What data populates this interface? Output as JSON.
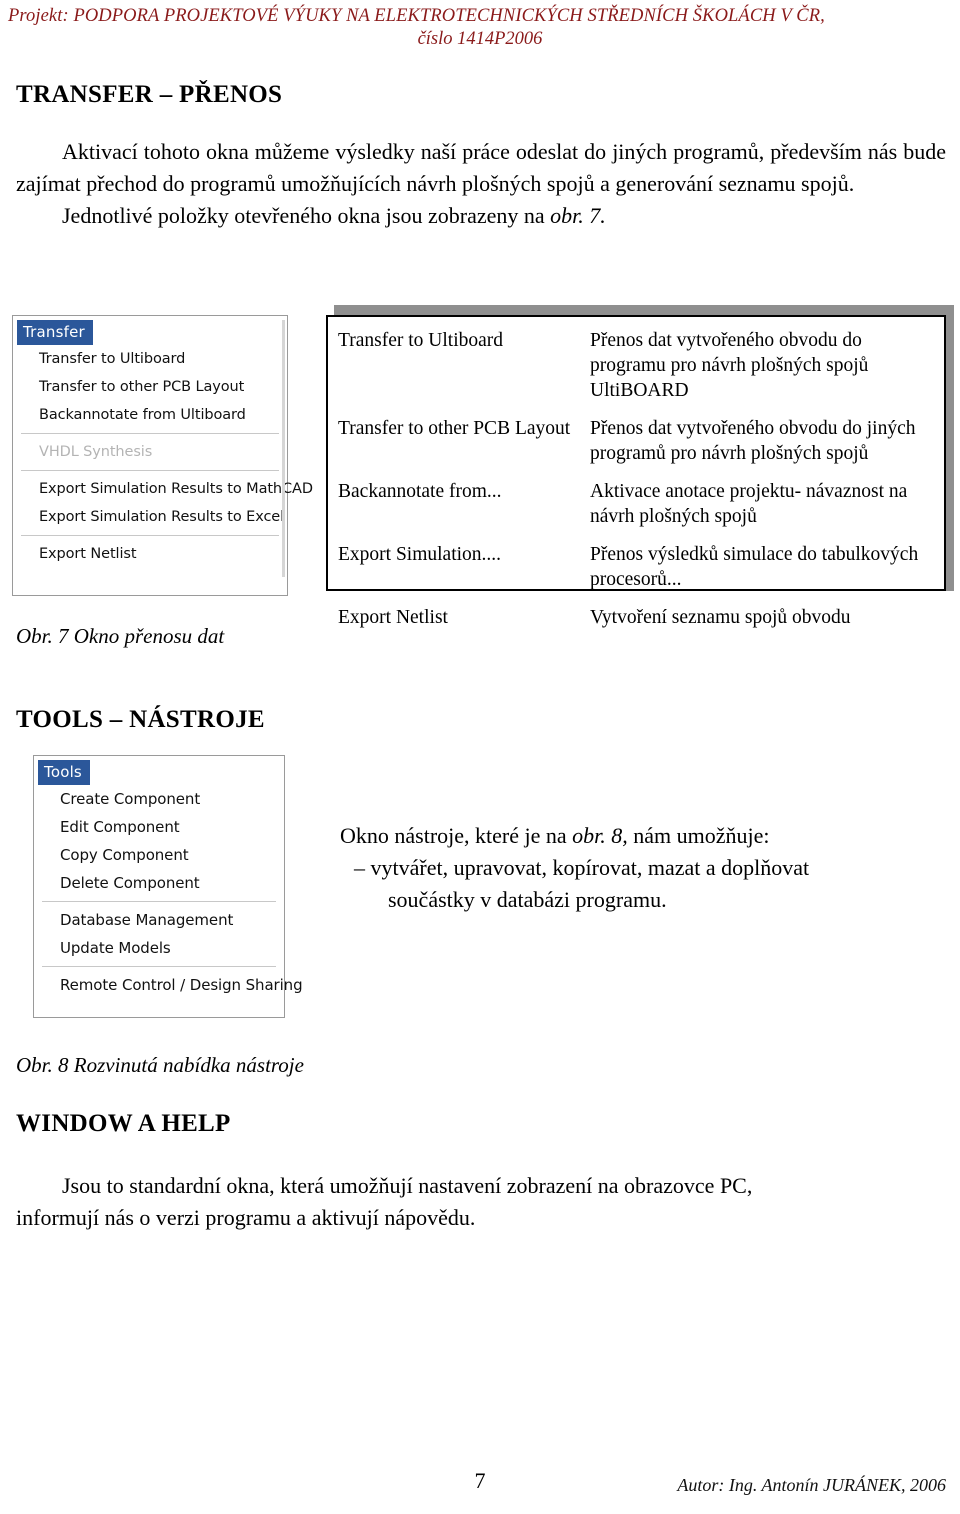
{
  "header": {
    "line1": "Projekt: PODPORA PROJEKTOVÉ VÝUKY NA ELEKTROTECHNICKÝCH STŘEDNÍCH ŠKOLÁCH V ČR,",
    "line2": "číslo 1414P2006",
    "color": "#8a1a1a"
  },
  "sections": {
    "transfer_title": "TRANSFER – PŘENOS",
    "tools_title": "TOOLS – NÁSTROJE",
    "window_title": "WINDOW A HELP"
  },
  "intro_paragraph": {
    "line_a": "Aktivací tohoto okna můžeme výsledky naší práce odeslat do jiných programů, především nás bude zajímat přechod do programů umožňujících návrh plošných spojů a generování seznamu spojů.",
    "line_b_prefix": "Jednotlivé položky otevřeného okna jsou zobrazeny na ",
    "line_b_italic": "obr. 7.",
    "line_b_suffix": ""
  },
  "transfer_menu": {
    "title": "Transfer",
    "title_bg": "#2b579a",
    "groups": [
      {
        "items": [
          {
            "label": "Transfer to Ultiboard",
            "disabled": false
          },
          {
            "label": "Transfer to other PCB Layout",
            "disabled": false
          },
          {
            "label": "Backannotate from Ultiboard",
            "disabled": false
          }
        ]
      },
      {
        "items": [
          {
            "label": "VHDL Synthesis",
            "disabled": true
          }
        ]
      },
      {
        "items": [
          {
            "label": "Export Simulation Results to MathCAD",
            "disabled": false
          },
          {
            "label": "Export Simulation Results to Excel",
            "disabled": false
          }
        ]
      },
      {
        "items": [
          {
            "label": "Export Netlist",
            "disabled": false
          }
        ]
      }
    ]
  },
  "transfer_table": {
    "rows": [
      {
        "command": "Transfer to Ultiboard",
        "description": "Přenos dat vytvořeného obvodu do programu pro návrh plošných spojů UltiBOARD"
      },
      {
        "command": "Transfer to other PCB Layout",
        "description": "Přenos dat vytvořeného obvodu do jiných programů pro návrh plošných spojů"
      },
      {
        "command": "Backannotate from...",
        "description": "Aktivace anotace projektu- návaznost na návrh plošných spojů"
      },
      {
        "command": "Export Simulation....",
        "description": "Přenos výsledků simulace do tabulkových procesorů..."
      },
      {
        "command": "Export Netlist",
        "description": "Vytvoření seznamu spojů obvodu"
      }
    ]
  },
  "captions": {
    "fig7": "Obr. 7 Okno přenosu dat",
    "fig8": "Obr. 8 Rozvinutá nabídka nástroje"
  },
  "tools_menu": {
    "title": "Tools",
    "title_bg": "#2b579a",
    "groups": [
      {
        "items": [
          {
            "label": "Create Component",
            "disabled": false
          },
          {
            "label": "Edit Component",
            "disabled": false
          },
          {
            "label": "Copy Component",
            "disabled": false
          },
          {
            "label": "Delete Component",
            "disabled": false
          }
        ]
      },
      {
        "items": [
          {
            "label": "Database Management",
            "disabled": false
          },
          {
            "label": "Update Models",
            "disabled": false
          }
        ]
      },
      {
        "items": [
          {
            "label": "Remote Control / Design Sharing",
            "disabled": false
          }
        ]
      }
    ]
  },
  "tools_text": {
    "line1_prefix": "Okno nástroje, které je na ",
    "line1_italic": "obr. 8,",
    "line1_suffix": " nám umožňuje:",
    "line2": "– vytvářet, upravovat, kopírovat, mazat a doplňovat",
    "line3": "součástky v databázi programu."
  },
  "window_paragraph": {
    "line1": "Jsou to standardní okna, která umožňují nastavení zobrazení na obrazovce PC,",
    "line2": "informují nás o verzi programu a aktivují nápovědu."
  },
  "footer": {
    "page_number": "7",
    "author": "Autor: Ing. Antonín JURÁNEK, 2006"
  }
}
